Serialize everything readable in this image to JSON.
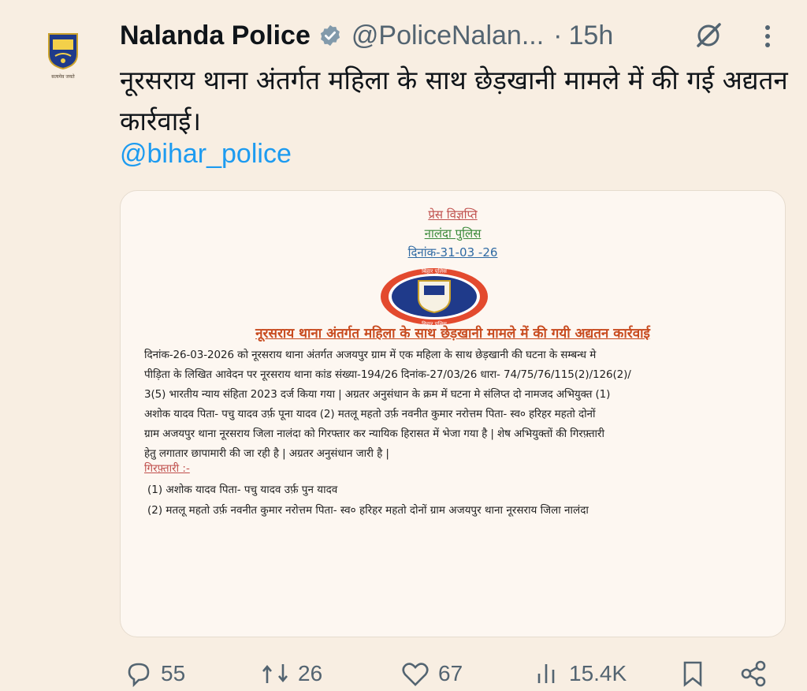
{
  "account": {
    "name": "Nalanda Police",
    "handle": "@PoliceNalan...",
    "separator": "·",
    "time": "15h",
    "avatar_text": "बिहार पुलिस",
    "avatar_motto": "सत्यमेव जयते"
  },
  "tweet": {
    "text": "नूरसराय थाना अंतर्गत महिला के साथ छेड़खानी मामले में की गई अद्यतन कार्रवाई।",
    "mention": "@bihar_police"
  },
  "image": {
    "press_release": "प्रेस विज्ञप्ति",
    "org": "नालंदा पुलिस",
    "date": "दिनांक-31-03 -26",
    "emblem_top": "बिहार पुलिस",
    "emblem_bottom": "बिहार पुलिस",
    "heading": "नूरसराय थाना अंतर्गत महिला के साथ छेड़खानी मामले  में की गयी अद्यतन कार्रवाई",
    "body_lines": [
      "दिनांक-26-03-2026 को नूरसराय थाना अंतर्गत अजयपुर ग्राम में एक महिला के साथ छेड़खानी की घटना के सम्बन्ध मे",
      "पीड़िता के लिखित आवेदन पर नूरसराय थाना कांड संख्या-194/26 दिनांक-27/03/26 धारा- 74/75/76/115(2)/126(2)/",
      "3(5) भारतीय न्याय संहिता 2023 दर्ज किया गया | अग्रतर अनुसंधान के क्रम में घटना मे संलिप्त दो नामजद अभियुक्त (1)",
      "अशोक यादव पिता- पचु यादव उर्फ़ पूना यादव (2) मतलू महतो उर्फ़ नवनीत कुमार नरोत्तम पिता- स्व० हरिहर महतो दोनों",
      "ग्राम अजयपुर थाना नूरसराय जिला नालंदा को गिरफ्तार कर न्यायिक हिरासत में भेजा गया है | शेष अभियुक्तों की गिरफ़्तारी",
      "हेतु लगातार छापामारी की जा रही है | अग्रतर अनुसंधान जारी है |"
    ],
    "arrest_title": "गिरफ़्तारी :-",
    "arrest_list": [
      "(1) अशोक यादव पिता- पचु यादव उर्फ़ पुन यादव",
      "(2) मतलू महतो उर्फ़ नवनीत कुमार नरोत्तम पिता- स्व० हरिहर महतो दोनों ग्राम अजयपुर थाना नूरसराय जिला नालंदा"
    ]
  },
  "actions": {
    "replies": "55",
    "reposts": "26",
    "likes": "67",
    "views": "15.4K"
  },
  "colors": {
    "background": "#f8eee2",
    "accent": "#1d9bf0",
    "muted": "#536471"
  }
}
